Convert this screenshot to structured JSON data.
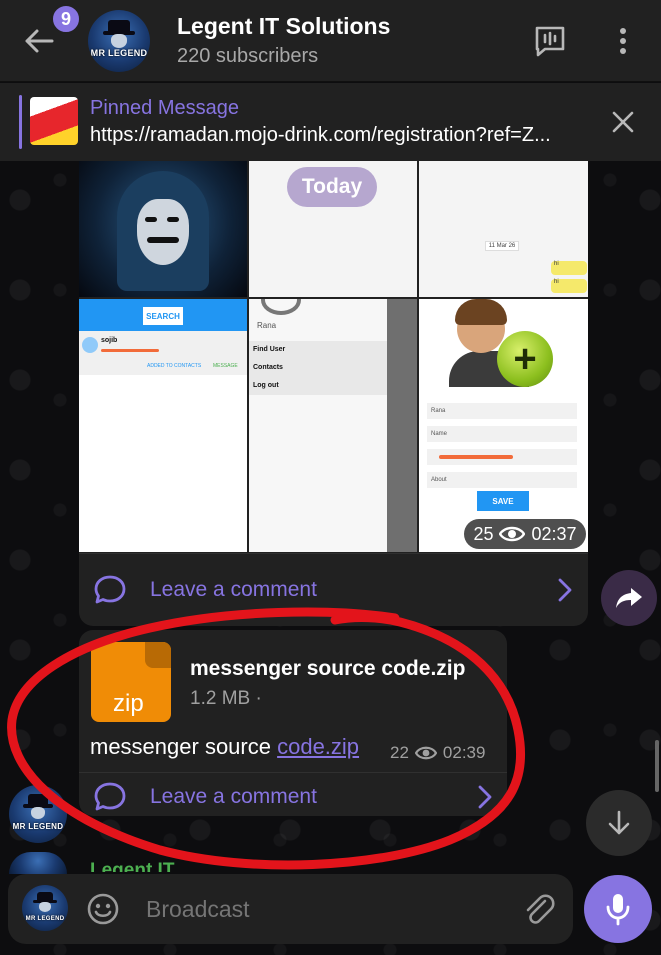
{
  "header": {
    "unread_badge": "9",
    "title": "Legent IT Solutions",
    "subtitle": "220 subscribers",
    "avatar_text": "MR LEGEND"
  },
  "pinned": {
    "title": "Pinned Message",
    "text": "https://ramadan.mojo-drink.com/registration?ref=Z..."
  },
  "album": {
    "screens": {
      "today_label": "Today",
      "date_chip": "11 Mar 26",
      "bubble_text": "hi",
      "search_button": "SEARCH",
      "contact_name": "sojib",
      "added_to_contacts": "ADDED TO CONTACTS",
      "message_action": "MESSAGE",
      "menu_name": "Rana",
      "menu_items": [
        "Find User",
        "Contacts",
        "Log out"
      ],
      "form_fields": [
        "Rana",
        "Name",
        "",
        "About"
      ],
      "save_button": "SAVE"
    },
    "views": "25",
    "time": "02:37",
    "comment_label": "Leave a comment"
  },
  "file_post": {
    "icon_label": "zip",
    "file_name": "messenger source code.zip",
    "file_size": "1.2 MB ·",
    "caption_plain": "messenger source ",
    "caption_link": "code.zip",
    "views": "22",
    "time": "02:39",
    "comment_label": "Leave a comment"
  },
  "partial_sender": "Legent IT Solutions",
  "composer": {
    "placeholder": "Broadcast"
  },
  "colors": {
    "accent": "#8774e1",
    "annotation": "#e3141b",
    "zip_orange": "#f08c06"
  }
}
